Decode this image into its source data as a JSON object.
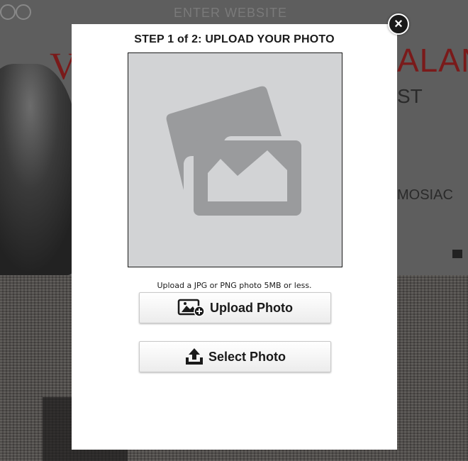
{
  "background": {
    "enter_website": "ENTER WEBSITE",
    "title_left": "V",
    "title_right": "ALAN",
    "subtitle": "ST",
    "mosaic_text": "MOSIAC"
  },
  "modal": {
    "title": "STEP 1 of 2: UPLOAD YOUR PHOTO",
    "close_label": "×",
    "hint": "Upload a JPG or PNG photo 5MB or less.",
    "upload_button_label": "Upload Photo",
    "select_button_label": "Select Photo"
  },
  "icons": {
    "close": "close-icon",
    "photo_placeholder": "image-placeholder-icon",
    "upload_photo": "image-plus-icon",
    "select_photo": "upload-tray-icon"
  },
  "colors": {
    "overlay": "#5e5e5e",
    "placeholder_bg": "#d2d3d5",
    "placeholder_icon": "#9a9b9d",
    "accent_red": "#7a1a1a"
  }
}
